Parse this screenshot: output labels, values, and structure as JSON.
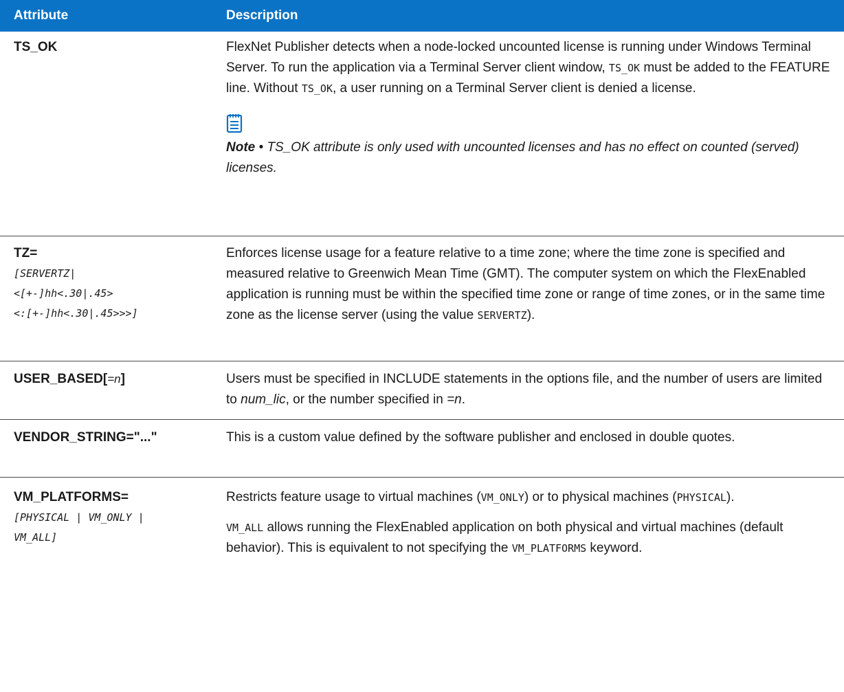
{
  "header": {
    "col_attribute": "Attribute",
    "col_description": "Description"
  },
  "rows": {
    "ts_ok": {
      "attr": "TS_OK",
      "desc_a": "FlexNet Publisher detects when a node-locked uncounted license is running under Windows Terminal Server. To run the application via a Terminal Server client window, ",
      "code1": "TS_OK",
      "desc_b": " must be added to the FEATURE line. Without ",
      "code2": "TS_OK",
      "desc_c": ", a user running on a Terminal Server client is denied a license.",
      "note_label": "Note",
      "note_sep": " • ",
      "note_text": "TS_OK attribute is only used with uncounted licenses and has no effect on counted (served) licenses."
    },
    "tz": {
      "attr": "TZ=",
      "sig1": "[SERVERTZ|",
      "sig2": "<[+-]hh<.30|.45>",
      "sig3": "<:[+-]hh<.30|.45>>>]",
      "desc_a": "Enforces license usage for a feature relative to a time zone; where the time zone is specified and measured relative to Greenwich Mean Time (GMT). The computer system on which the FlexEnabled application is running must be within the specified time zone or range of time zones, or in the same time zone as the license server (using the value ",
      "code1": "SERVERTZ",
      "desc_b": ")."
    },
    "user_based": {
      "attr_a": "USER_BASED[",
      "attr_n": "=n",
      "attr_b": "]",
      "desc_a": "Users must be specified in INCLUDE statements in the options file, and the number of users are limited to ",
      "ital1": "num_lic",
      "desc_b": ", or the number specified in ",
      "ital2": "=n",
      "desc_c": "."
    },
    "vendor_string": {
      "attr": "VENDOR_STRING=\"...\"",
      "desc": "This is a custom value defined by the software publisher and enclosed in double quotes."
    },
    "vm_platforms": {
      "attr": "VM_PLATFORMS=",
      "sig1": "[PHYSICAL | VM_ONLY |",
      "sig2": "VM_ALL]",
      "p1_a": "Restricts feature usage to virtual machines (",
      "p1_code1": "VM_ONLY",
      "p1_b": ") or to physical machines (",
      "p1_code2": "PHYSICAL",
      "p1_c": ").",
      "p2_code1": "VM_ALL",
      "p2_a": " allows running the FlexEnabled application on both physical and virtual machines (default behavior). This is equivalent to not specifying the ",
      "p2_code2": "VM_PLATFORMS",
      "p2_b": " keyword."
    }
  },
  "icons": {
    "note": "notepad-icon"
  },
  "colors": {
    "header_bg": "#0b73c5",
    "header_text": "#ffffff",
    "rule": "#4a4a4a"
  }
}
